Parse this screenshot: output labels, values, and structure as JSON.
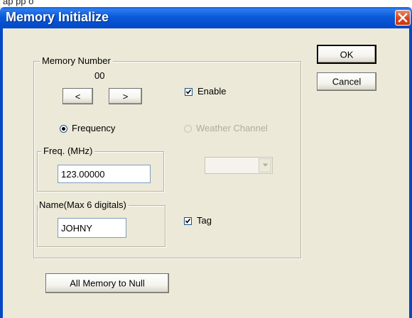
{
  "background_app": {
    "visible_text": "ap pp o"
  },
  "window": {
    "title": "Memory Initialize",
    "close_icon": "close-icon"
  },
  "buttons": {
    "ok": "OK",
    "cancel": "Cancel",
    "all_memory_null": "All Memory to Null"
  },
  "memory_group": {
    "legend": "Memory Number",
    "number": "00",
    "prev_label": "<",
    "next_label": ">"
  },
  "enable": {
    "label": "Enable",
    "checked": true
  },
  "mode": {
    "frequency_label": "Frequency",
    "frequency_selected": true,
    "weather_label": "Weather Channel",
    "weather_enabled": false
  },
  "freq_group": {
    "legend": "Freq. (MHz)",
    "value": "123.00000"
  },
  "weather_combo": {
    "selected": ""
  },
  "name_group": {
    "legend": "Name(Max 6 digitals)",
    "value": "JOHNY"
  },
  "tag": {
    "label": "Tag",
    "checked": true
  },
  "colors": {
    "titlebar": "#0b5ad9",
    "dialog_bg": "#ece9d8",
    "close": "#d9431c",
    "disabled_text": "#b0ad9f"
  }
}
